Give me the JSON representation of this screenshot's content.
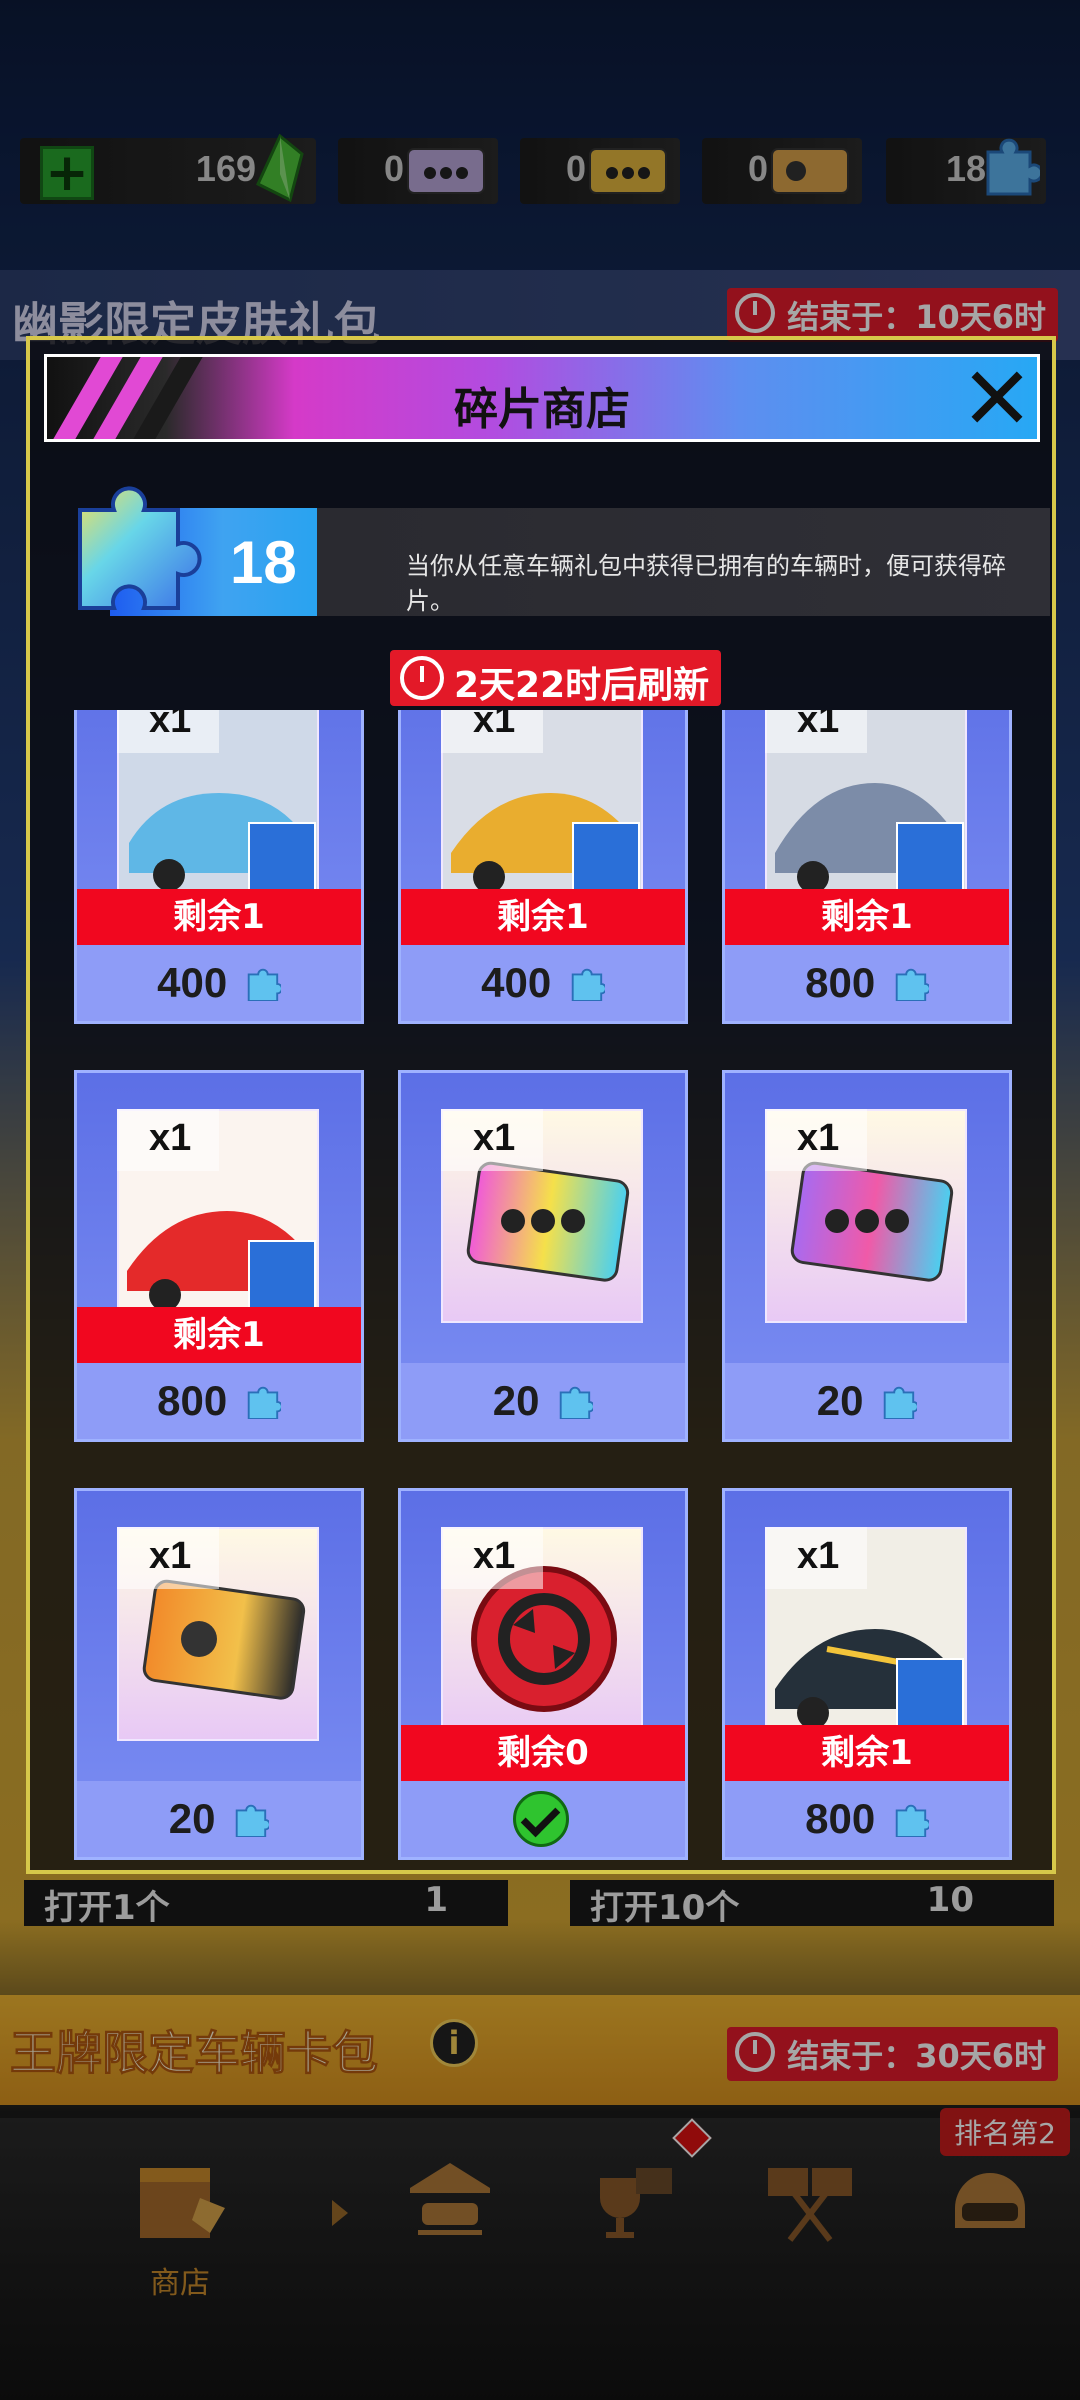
{
  "topbar": {
    "currencies": [
      {
        "name": "gem-currency",
        "value": "169"
      },
      {
        "name": "ticket-currency-1",
        "value": "0"
      },
      {
        "name": "ticket-currency-2",
        "value": "0"
      },
      {
        "name": "ticket-currency-3",
        "value": "0"
      },
      {
        "name": "fragment-currency",
        "value": "18"
      }
    ]
  },
  "background": {
    "banner1_title": "幽影限定皮肤礼包",
    "banner1_timer": "结束于：10天6时",
    "banner2_title": "王牌限定车辆卡包",
    "banner2_timer": "结束于：30天6时",
    "open1": "打开1个",
    "open1_cost": "1",
    "open10": "打开10个",
    "open10_cost": "10"
  },
  "modal": {
    "title": "碎片商店",
    "fragment_count": "18",
    "description": "当你从任意车辆礼包中获得已拥有的车辆时，便可获得碎片。",
    "refresh": "2天22时后刷新"
  },
  "items": [
    {
      "qty": "x1",
      "remain": "剩余1",
      "price": "400",
      "type": "car-blue-bmw"
    },
    {
      "qty": "x1",
      "remain": "剩余1",
      "price": "400",
      "type": "car-yellow-mclaren"
    },
    {
      "qty": "x1",
      "remain": "剩余1",
      "price": "800",
      "type": "car-silver-hyper"
    },
    {
      "qty": "x1",
      "remain": "剩余1",
      "price": "800",
      "type": "car-red-alfa"
    },
    {
      "qty": "x1",
      "remain": "",
      "price": "20",
      "type": "ticket-rainbow"
    },
    {
      "qty": "x1",
      "remain": "",
      "price": "20",
      "type": "ticket-holo"
    },
    {
      "qty": "x1",
      "remain": "",
      "price": "20",
      "type": "ticket-gold"
    },
    {
      "qty": "x1",
      "remain": "剩余0",
      "price": "",
      "type": "red-coin",
      "purchased": true
    },
    {
      "qty": "x1",
      "remain": "剩余1",
      "price": "800",
      "type": "car-dark-mustang"
    }
  ],
  "nav": {
    "shop_label": "商店",
    "rank_badge": "排名第2"
  },
  "colors": {
    "accent_red": "#e31928",
    "card_blue": "#7d8ff3",
    "modal_border": "#d7c84a"
  }
}
